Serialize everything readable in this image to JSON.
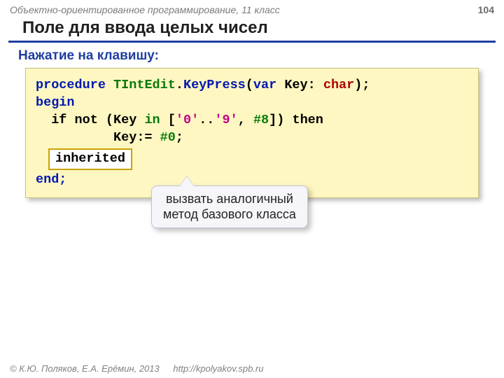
{
  "header": {
    "subject": "Объектно-ориентированное программирование, 11 класс",
    "page": "104"
  },
  "title": "Поле для ввода целых чисел",
  "subtitle": "Нажатие на клавишу:",
  "code": {
    "l1": {
      "proc": "procedure",
      "cls": "TIntEdit",
      "dot": ".",
      "method": "KeyPress",
      "open": "(",
      "var": "var",
      "key": " Key: ",
      "type": "char",
      "close": ");"
    },
    "l2": "begin",
    "l3": {
      "pre": "  if not (Key ",
      "in": "in",
      "mid1": " [",
      "lit1": "'0'",
      "dots": "..",
      "lit2": "'9'",
      "comma": ", ",
      "h8": "#8",
      "mid2": "]) then"
    },
    "l4": {
      "pre": "          Key:= ",
      "h0": "#0",
      "semi": ";"
    },
    "inherited": "inherited",
    "l6": "end;"
  },
  "callout": {
    "line1": "вызвать аналогичный",
    "line2": "метод базового класса"
  },
  "footer": {
    "copyright": "© К.Ю. Поляков, Е.А. Ерёмин, 2013",
    "url": "http://kpolyakov.spb.ru"
  }
}
